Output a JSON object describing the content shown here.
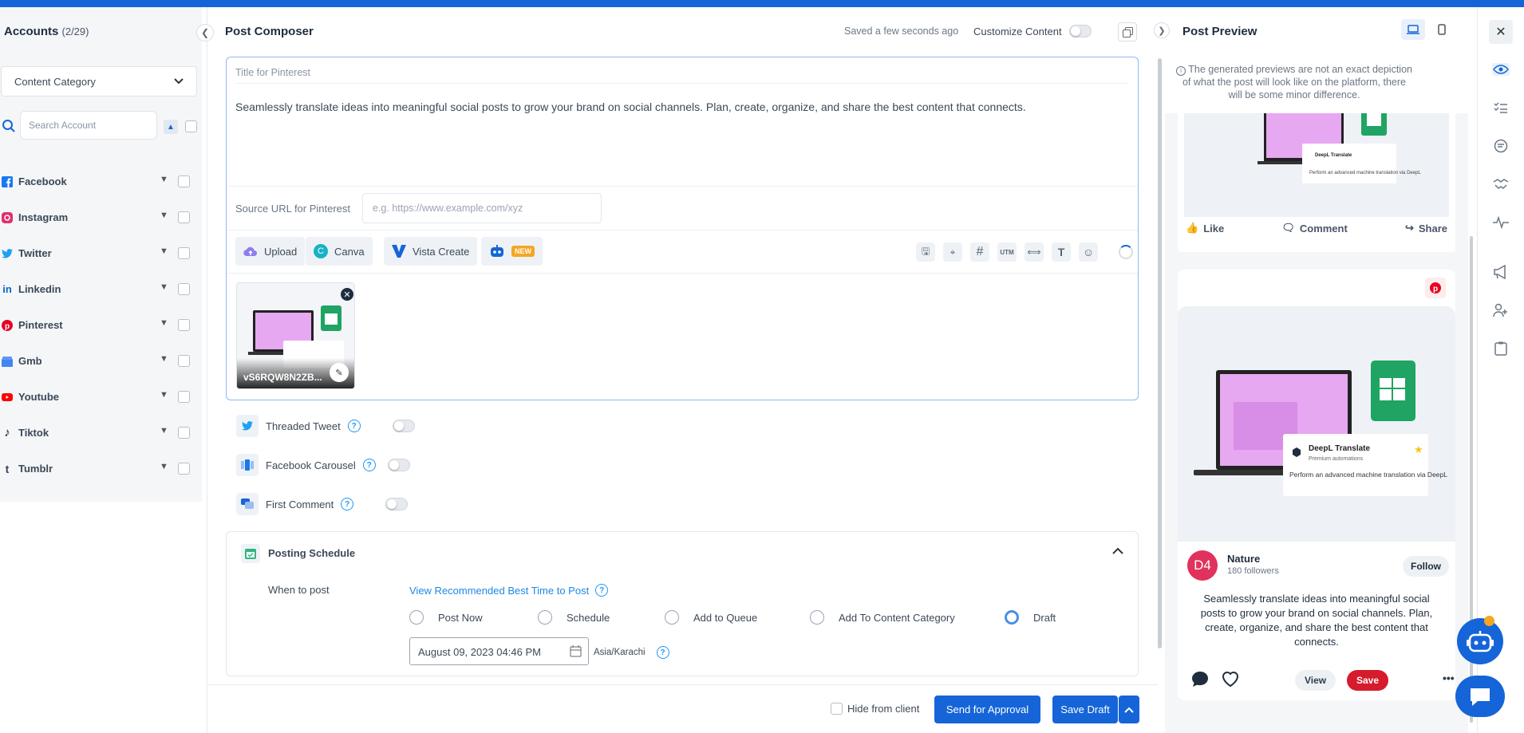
{
  "accounts": {
    "title": "Accounts",
    "count": "(2/29)",
    "category_select": "Content Category",
    "search_placeholder": "Search Account",
    "networks": [
      {
        "label": "Facebook",
        "icon": "facebook-icon",
        "color": "#1877f2"
      },
      {
        "label": "Instagram",
        "icon": "instagram-icon",
        "color": "#e1306c"
      },
      {
        "label": "Twitter",
        "icon": "twitter-icon",
        "color": "#1da1f2"
      },
      {
        "label": "Linkedin",
        "icon": "linkedin-icon",
        "color": "#0a66c2"
      },
      {
        "label": "Pinterest",
        "icon": "pinterest-icon",
        "color": "#e60023"
      },
      {
        "label": "Gmb",
        "icon": "gmb-icon",
        "color": "#4285f4"
      },
      {
        "label": "Youtube",
        "icon": "youtube-icon",
        "color": "#ff0000"
      },
      {
        "label": "Tiktok",
        "icon": "tiktok-icon",
        "color": "#111111"
      },
      {
        "label": "Tumblr",
        "icon": "tumblr-icon",
        "color": "#35465c"
      }
    ]
  },
  "composer": {
    "title": "Post Composer",
    "saved_status": "Saved a few seconds ago",
    "customize_label": "Customize Content",
    "pin_title_placeholder": "Title for Pinterest",
    "post_text": "Seamlessly translate ideas into meaningful social posts to grow your brand on social channels. Plan, create, organize, and share the best content that connects.",
    "source_url_label": "Source URL for Pinterest",
    "source_url_placeholder": "e.g. https://www.example.com/xyz",
    "tools": {
      "upload": "Upload",
      "canva": "Canva",
      "vista": "Vista Create",
      "new_badge": "NEW",
      "utm": "UTM"
    },
    "media_name": "vS6RQW8N2ZB...",
    "options": {
      "threaded": "Threaded Tweet",
      "carousel": "Facebook Carousel",
      "first_comment": "First Comment"
    },
    "schedule": {
      "title": "Posting Schedule",
      "when_label": "When to post",
      "recommended_link": "View Recommended Best Time to Post",
      "radios": [
        "Post Now",
        "Schedule",
        "Add to Queue",
        "Add To Content Category",
        "Draft"
      ],
      "selected": "Draft",
      "date_value": "August 09, 2023 04:46 PM",
      "timezone": "Asia/Karachi"
    },
    "footer": {
      "hide_client": "Hide from client",
      "send_approval": "Send for Approval",
      "save_draft": "Save Draft"
    }
  },
  "preview": {
    "title": "Post Preview",
    "note": "The generated previews are not an exact depiction of what the post will look like on the platform, there will be some minor difference.",
    "fb_actions": {
      "like": "Like",
      "comment": "Comment",
      "share": "Share"
    },
    "pin": {
      "avatar_text": "D4",
      "name": "Nature",
      "followers": "180 followers",
      "follow": "Follow",
      "text": "Seamlessly translate ideas into meaningful social posts to grow your brand on social channels. Plan, create, organize, and share the best content that connects.",
      "view": "View",
      "save": "Save",
      "more": "•••"
    },
    "mock": {
      "card_title": "DeepL Translate",
      "card_sub": "Premium automations",
      "card_body": "Perform an advanced machine translation via DeepL"
    }
  },
  "colors": {
    "accent": "#1565d8",
    "pinterest": "#d51b2c",
    "avatar": "#e0325c"
  }
}
